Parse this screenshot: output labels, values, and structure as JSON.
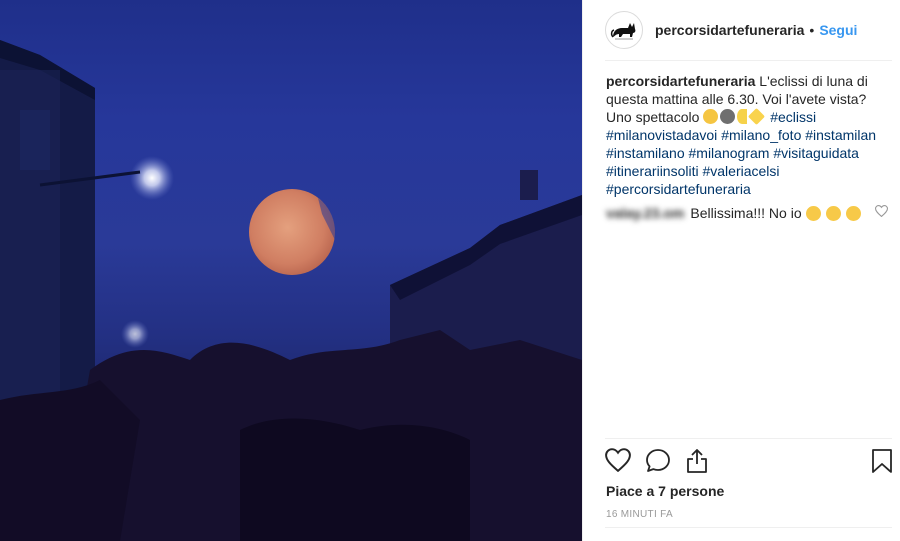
{
  "post": {
    "username": "percorsidartefuneraria",
    "separator": "•",
    "follow_label": "Segui",
    "caption": {
      "text_before_emoji": "L'eclissi di luna di questa mattina alle 6.30. Voi l'avete vista? Uno spettacolo",
      "hashtags": [
        "#eclissi",
        "#milanovistadavoi",
        "#milano_foto",
        "#instamilan",
        "#instamilano",
        "#milanogram",
        "#visitaguidata",
        "#itinerariinsoliti",
        "#valeriacelsi",
        "#percorsidartefuneraria"
      ]
    },
    "comment": {
      "username": "valay.23.om",
      "text": "Bellissima!!! No io"
    },
    "likes_text": "Piace a 7 persone",
    "timestamp": "16 MINUTI FA"
  },
  "icons": {
    "avatar": "black-cat-logo",
    "like": "heart-icon",
    "comment": "speech-bubble-icon",
    "share": "share-icon",
    "save": "bookmark-icon",
    "comment_like": "small-heart-icon"
  },
  "colors": {
    "link": "#3897f0",
    "hashtag": "#003569",
    "text": "#262626",
    "muted": "#999999"
  }
}
